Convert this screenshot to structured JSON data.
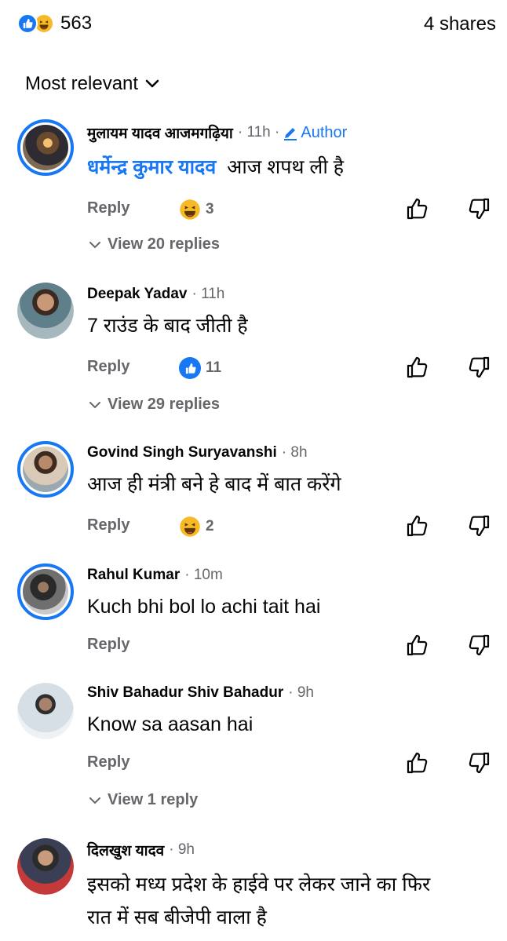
{
  "header": {
    "reaction_count": "563",
    "shares": "4 shares"
  },
  "sort": {
    "label": "Most relevant"
  },
  "comments": [
    {
      "name": "मुलायम यादव आजमगढ़िया",
      "time": "· 11h ·",
      "author_badge": "Author",
      "mention": "धर्मेन्द्र कुमार यादव",
      "text": "आज शपथ ली है",
      "reply_label": "Reply",
      "reaction_type": "haha",
      "reaction_count": "3",
      "view_replies": "View 20 replies"
    },
    {
      "name": "Deepak Yadav",
      "time": "· 11h",
      "text": "7 राउंड के बाद जीती है",
      "reply_label": "Reply",
      "reaction_type": "like",
      "reaction_count": "11",
      "view_replies": "View 29 replies"
    },
    {
      "name": "Govind Singh Suryavanshi",
      "time": "· 8h",
      "text": "आज ही मंत्री बने हे बाद में बात करेंगे",
      "reply_label": "Reply",
      "reaction_type": "haha",
      "reaction_count": "2"
    },
    {
      "name": "Rahul Kumar",
      "time": "· 10m",
      "text": "Kuch bhi bol lo achi tait hai",
      "reply_label": "Reply"
    },
    {
      "name": "Shiv Bahadur Shiv Bahadur",
      "time": "· 9h",
      "text": "Know sa aasan hai",
      "reply_label": "Reply",
      "view_replies": "View 1 reply"
    },
    {
      "name": "दिलखुश यादव",
      "time": "· 9h",
      "text_line1": "इसको मध्य प्रदेश के हाईवे पर लेकर जाने का फिर",
      "text_line2": "रात में सब बीजेपी वाला है"
    }
  ],
  "colors": {
    "accent": "#1877f2",
    "secondary_text": "#65676b",
    "haha": "#f7b928"
  },
  "icons": [
    "like-reaction-icon",
    "haha-reaction-icon",
    "chevron-down-icon",
    "pencil-icon",
    "thumbs-up-icon",
    "thumbs-down-icon"
  ]
}
